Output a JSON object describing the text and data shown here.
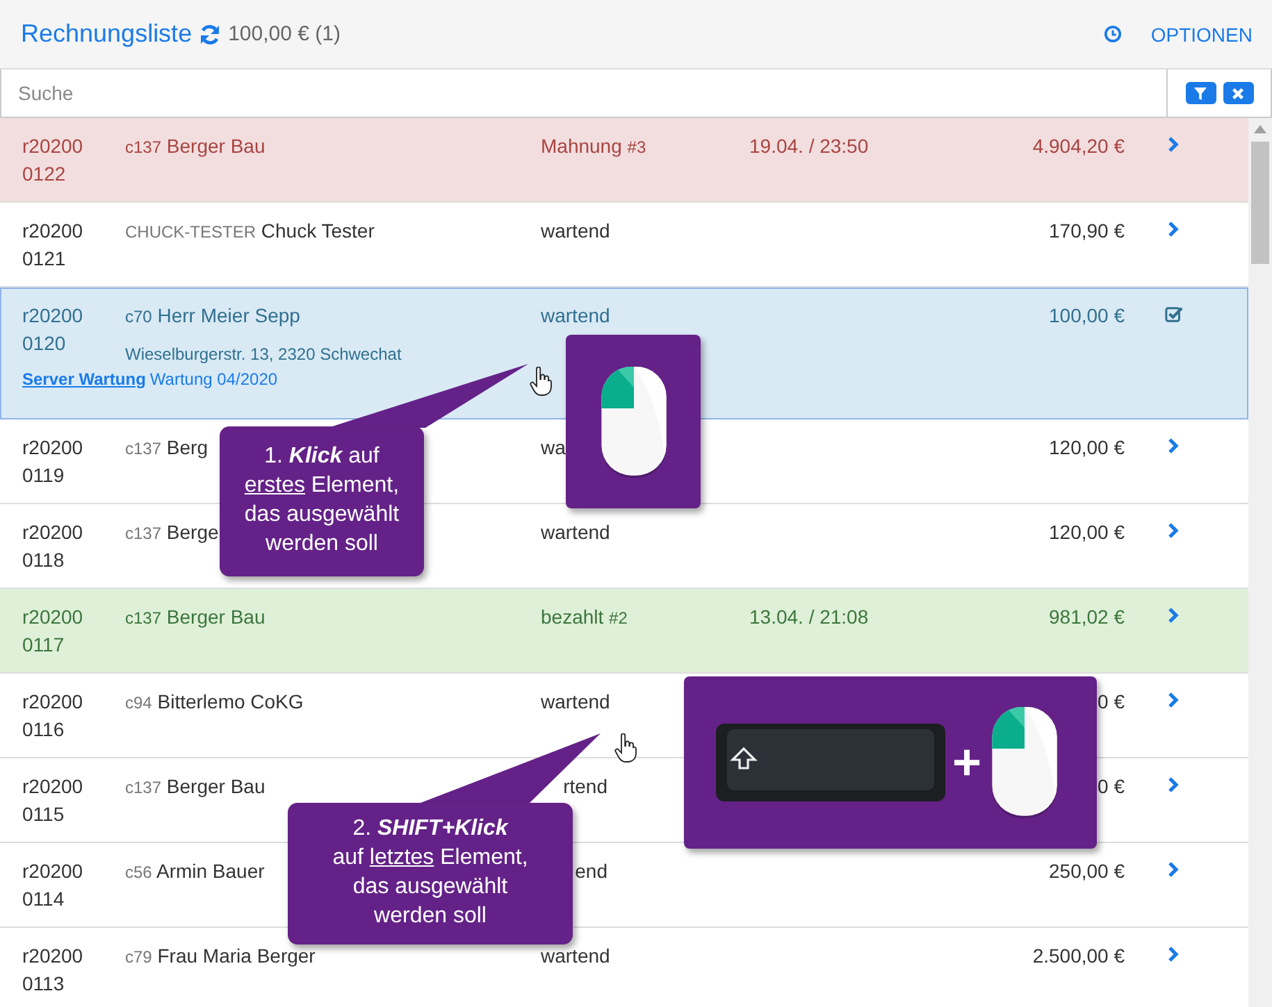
{
  "header": {
    "title": "Rechnungsliste",
    "summary": "100,00 € (1)",
    "options_link": "OPTIONEN"
  },
  "search": {
    "placeholder": "Suche"
  },
  "rows": [
    {
      "number": "r202000122",
      "code": "c137",
      "customer": "Berger Bau",
      "status": "Mahnung",
      "status_count": "#3",
      "date": "19.04. / 23:50",
      "amount": "4.904,20 €",
      "kind": "overdue",
      "selected": false
    },
    {
      "number": "r202000121",
      "code": "CHUCK-TESTER",
      "customer": "Chuck Tester",
      "status": "wartend",
      "amount": "170,90 €",
      "kind": "pending",
      "selected": false
    },
    {
      "number": "r202000120",
      "code": "c70",
      "customer": "Herr Meier Sepp",
      "status": "wartend",
      "amount": "100,00 €",
      "kind": "pending",
      "selected": true,
      "address": "Wieselburgerstr. 13, 2320 Schwechat",
      "project_link": "Server Wartung",
      "project_note": "Wartung 04/2020"
    },
    {
      "number": "r202000119",
      "code": "c137",
      "customer": "Berg",
      "status": "wa",
      "amount": "120,00 €",
      "kind": "pending",
      "selected": false
    },
    {
      "number": "r202000118",
      "code": "c137",
      "customer": "Berge",
      "status": "wartend",
      "amount": "120,00 €",
      "kind": "pending",
      "selected": false
    },
    {
      "number": "r202000117",
      "code": "c137",
      "customer": "Berger Bau",
      "status": "bezahlt",
      "status_count": "#2",
      "date": "13.04. / 21:08",
      "amount": "981,02 €",
      "kind": "paid",
      "selected": false
    },
    {
      "number": "r202000116",
      "code": "c94",
      "customer": "Bitterlemo CoKG",
      "status": "wartend",
      "amount": "0 €",
      "kind": "pending",
      "selected": false
    },
    {
      "number": "r202000115",
      "code": "c137",
      "customer": "Berger Bau",
      "status": "rtend",
      "status_cut_left": true,
      "amount": "0 €",
      "kind": "pending",
      "selected": false
    },
    {
      "number": "r202000114",
      "code": "c56",
      "customer": "Armin Bauer",
      "status": "end",
      "status_cut_left": true,
      "amount": "250,00 €",
      "kind": "pending",
      "selected": false
    },
    {
      "number": "r202000113",
      "code": "c79",
      "customer": "Frau Maria Berger",
      "status": "wartend",
      "amount": "2.500,00 €",
      "kind": "pending",
      "selected": false
    }
  ],
  "callouts": [
    {
      "lines": [
        [
          {
            "text": "1. ",
            "kind": "plain"
          },
          {
            "text": "Klick",
            "kind": "emphasis"
          },
          {
            "text": " auf",
            "kind": "plain"
          }
        ],
        [
          {
            "text": "erstes",
            "kind": "underlined"
          },
          {
            "text": " Element,",
            "kind": "plain"
          }
        ],
        [
          {
            "text": "das ausgewählt",
            "kind": "plain"
          }
        ],
        [
          {
            "text": "werden soll",
            "kind": "plain"
          }
        ]
      ]
    },
    {
      "lines": [
        [
          {
            "text": "2. ",
            "kind": "plain"
          },
          {
            "text": "SHIFT+Klick",
            "kind": "emphasis"
          }
        ],
        [
          {
            "text": "auf ",
            "kind": "plain"
          },
          {
            "text": "letztes",
            "kind": "underlined"
          },
          {
            "text": " Element,",
            "kind": "plain"
          }
        ],
        [
          {
            "text": "das ausgewählt",
            "kind": "plain"
          }
        ],
        [
          {
            "text": "werden soll",
            "kind": "plain"
          }
        ]
      ]
    }
  ],
  "shortcut_panel": {
    "plus": "+"
  }
}
